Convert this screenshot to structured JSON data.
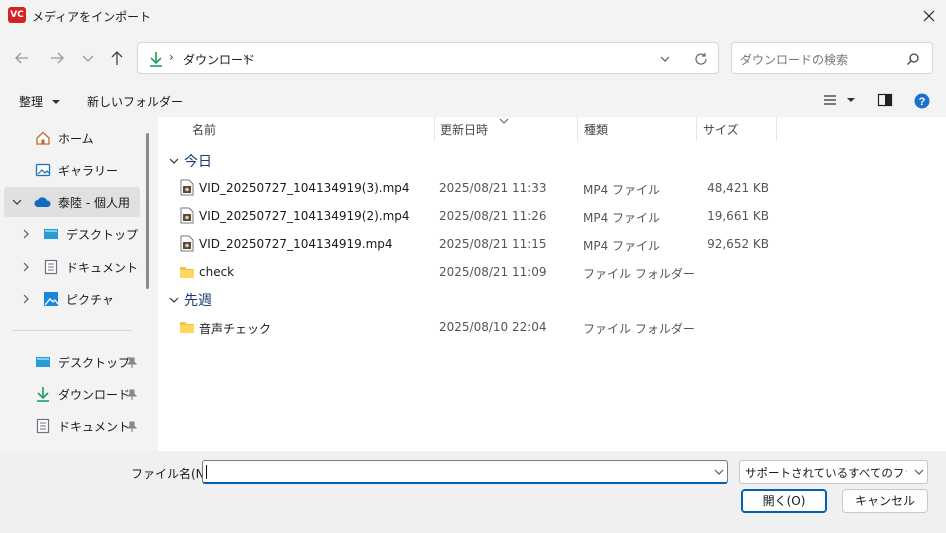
{
  "window": {
    "title": "メディアをインポート",
    "app_icon_text": "VC"
  },
  "address_bar": {
    "breadcrumb_separator": "›",
    "location": "ダウンロード"
  },
  "search": {
    "placeholder": "ダウンロードの検索"
  },
  "toolbar": {
    "organize_label": "整理",
    "new_folder_label": "新しいフォルダー"
  },
  "sidebar": {
    "items": [
      {
        "label": "ホーム",
        "icon": "home-icon"
      },
      {
        "label": "ギャラリー",
        "icon": "gallery-icon"
      },
      {
        "label": "泰陸 - 個人用",
        "icon": "onedrive-icon"
      },
      {
        "label": "デスクトップ",
        "icon": "desktop-icon"
      },
      {
        "label": "ドキュメント",
        "icon": "document-icon"
      },
      {
        "label": "ピクチャ",
        "icon": "pictures-icon"
      }
    ],
    "pinned": [
      {
        "label": "デスクトップ",
        "icon": "desktop-icon"
      },
      {
        "label": "ダウンロード",
        "icon": "download-icon"
      },
      {
        "label": "ドキュメント",
        "icon": "document-icon"
      }
    ]
  },
  "columns": {
    "name": "名前",
    "date": "更新日時",
    "type": "種類",
    "size": "サイズ"
  },
  "groups": [
    {
      "label": "今日",
      "rows": [
        {
          "name": "VID_20250727_104134919(3).mp4",
          "date": "2025/08/21 11:33",
          "type": "MP4 ファイル",
          "size": "48,421 KB",
          "kind": "video"
        },
        {
          "name": "VID_20250727_104134919(2).mp4",
          "date": "2025/08/21 11:26",
          "type": "MP4 ファイル",
          "size": "19,661 KB",
          "kind": "video"
        },
        {
          "name": "VID_20250727_104134919.mp4",
          "date": "2025/08/21 11:15",
          "type": "MP4 ファイル",
          "size": "92,652 KB",
          "kind": "video"
        },
        {
          "name": "check",
          "date": "2025/08/21 11:09",
          "type": "ファイル フォルダー",
          "size": "",
          "kind": "folder"
        }
      ]
    },
    {
      "label": "先週",
      "rows": [
        {
          "name": "音声チェック",
          "date": "2025/08/10 22:04",
          "type": "ファイル フォルダー",
          "size": "",
          "kind": "folder"
        }
      ]
    }
  ],
  "bottom": {
    "filename_label": "ファイル名(N):",
    "filename_value": "",
    "filter_value": "サポートされているすべてのファイル (",
    "open_label": "開く(O)",
    "cancel_label": "キャンセル"
  },
  "colors": {
    "accent": "#005fb8",
    "folder": "#f4c23f",
    "onedrive": "#0f6cbd",
    "download_green": "#1aa260",
    "help_blue": "#1f6fd1"
  }
}
